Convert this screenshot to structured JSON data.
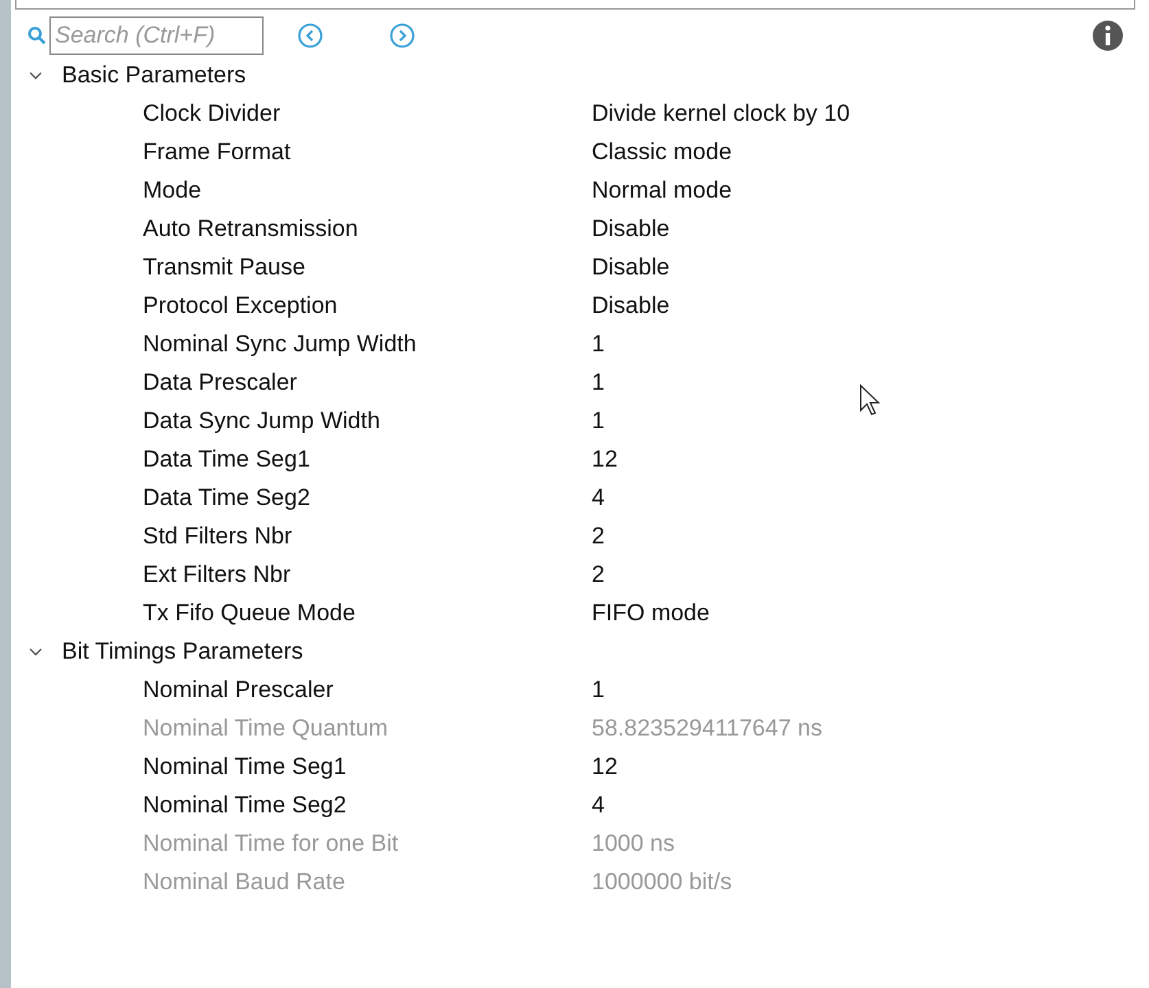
{
  "search": {
    "placeholder": "Search (Ctrl+F)"
  },
  "groups": [
    {
      "title": "Basic Parameters",
      "expanded": true,
      "params": [
        {
          "name": "Clock Divider",
          "value": "Divide kernel clock by 10",
          "disabled": false
        },
        {
          "name": "Frame Format",
          "value": "Classic mode",
          "disabled": false
        },
        {
          "name": "Mode",
          "value": "Normal mode",
          "disabled": false
        },
        {
          "name": "Auto Retransmission",
          "value": "Disable",
          "disabled": false
        },
        {
          "name": "Transmit Pause",
          "value": "Disable",
          "disabled": false
        },
        {
          "name": "Protocol Exception",
          "value": "Disable",
          "disabled": false
        },
        {
          "name": "Nominal Sync Jump Width",
          "value": "1",
          "disabled": false
        },
        {
          "name": "Data Prescaler",
          "value": "1",
          "disabled": false
        },
        {
          "name": "Data Sync Jump Width",
          "value": "1",
          "disabled": false
        },
        {
          "name": "Data Time Seg1",
          "value": "12",
          "disabled": false
        },
        {
          "name": "Data Time Seg2",
          "value": "4",
          "disabled": false
        },
        {
          "name": "Std Filters Nbr",
          "value": "2",
          "disabled": false
        },
        {
          "name": "Ext Filters Nbr",
          "value": "2",
          "disabled": false
        },
        {
          "name": "Tx Fifo Queue Mode",
          "value": "FIFO mode",
          "disabled": false
        }
      ]
    },
    {
      "title": "Bit Timings Parameters",
      "expanded": true,
      "params": [
        {
          "name": "Nominal Prescaler",
          "value": "1",
          "disabled": false
        },
        {
          "name": "Nominal Time Quantum",
          "value": "58.8235294117647 ns",
          "disabled": true
        },
        {
          "name": "Nominal Time Seg1",
          "value": "12",
          "disabled": false
        },
        {
          "name": "Nominal Time Seg2",
          "value": "4",
          "disabled": false
        },
        {
          "name": "Nominal Time for one Bit",
          "value": "1000 ns",
          "disabled": true
        },
        {
          "name": "Nominal Baud Rate",
          "value": "1000000 bit/s",
          "disabled": true
        }
      ]
    }
  ]
}
